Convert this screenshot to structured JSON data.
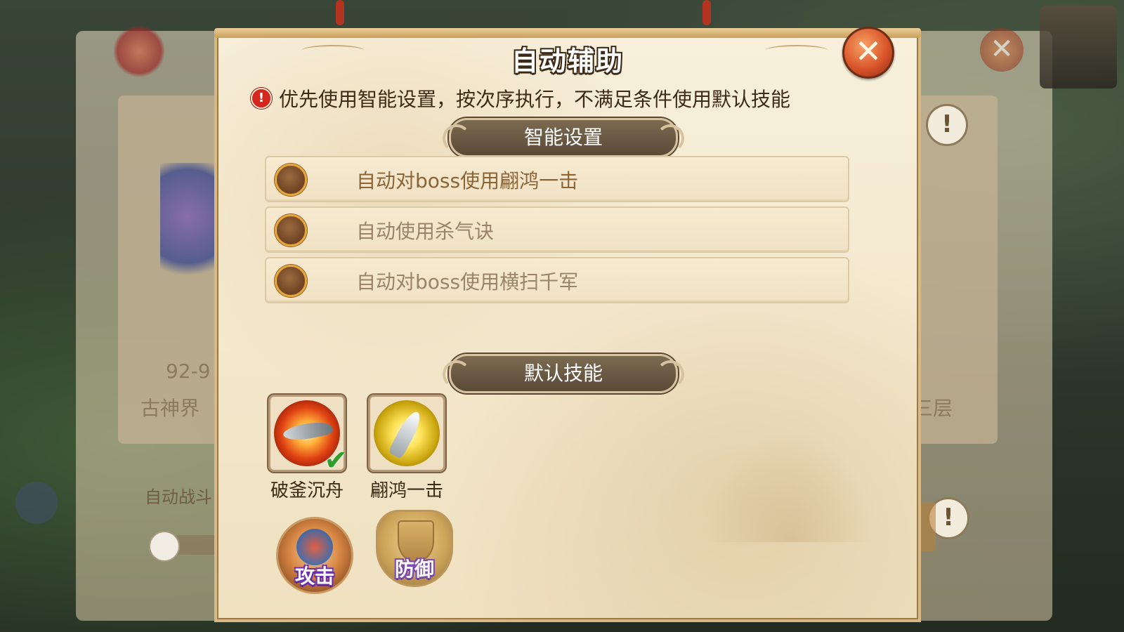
{
  "dialog": {
    "title": "自动辅助",
    "close_icon": "close-x-icon",
    "notice": "优先使用智能设置，按次序执行，不满足条件使用默认技能"
  },
  "smart_settings": {
    "header": "智能设置",
    "options": [
      {
        "label": "自动对boss使用翩鸿一击",
        "selected": false
      },
      {
        "label": "自动使用杀气诀",
        "selected": false
      },
      {
        "label": "自动对boss使用横扫千军",
        "selected": false
      }
    ]
  },
  "default_skills": {
    "header": "默认技能",
    "skills": [
      {
        "name": "破釜沉舟",
        "icon": "fire-blade-skill-icon",
        "checked": true
      },
      {
        "name": "翩鸿一击",
        "icon": "lightning-blade-skill-icon",
        "checked": false
      }
    ],
    "actions": [
      {
        "label": "攻击",
        "icon": "attack-icon"
      },
      {
        "label": "防御",
        "icon": "shield-icon"
      }
    ]
  },
  "background": {
    "level_text": "92-9",
    "map_text": "古神界",
    "right_text": "三层",
    "auto_battle_text": "自动战斗"
  },
  "colors": {
    "panel": "#f5e9cf",
    "title_outline": "#3a2914",
    "close": "#d9552a",
    "option_text": "#8b6538",
    "action_label_outline": "#6b2fb0",
    "check": "#2e9e2c"
  }
}
